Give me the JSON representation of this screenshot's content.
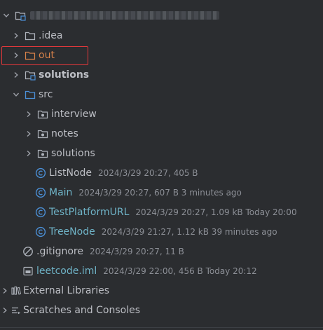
{
  "tree": {
    "idea": {
      "name": ".idea"
    },
    "out": {
      "name": "out"
    },
    "solutions_root": {
      "name": "solutions"
    },
    "src": {
      "name": "src",
      "children": [
        {
          "name": "interview"
        },
        {
          "name": "notes"
        },
        {
          "name": "solutions"
        }
      ],
      "files": [
        {
          "name": "ListNode",
          "meta": "2024/3/29 20:27, 405 B"
        },
        {
          "name": "Main",
          "meta": "2024/3/29 20:27, 607 B 3 minutes ago"
        },
        {
          "name": "TestPlatformURL",
          "meta": "2024/3/29 20:27, 1.09 kB Today 20:00"
        },
        {
          "name": "TreeNode",
          "meta": "2024/3/29 21:27, 1.12 kB 39 minutes ago"
        }
      ]
    },
    "gitignore": {
      "name": ".gitignore",
      "meta": "2024/3/29 20:27, 11 B"
    },
    "iml": {
      "name": "leetcode.iml",
      "meta": "2024/3/29 22:00, 456 B Today 20:12"
    },
    "external_libraries": {
      "name": "External Libraries"
    },
    "scratches": {
      "name": "Scratches and Consoles"
    }
  },
  "colors": {
    "background": "#2b2d30",
    "excluded_folder": "#d8824a",
    "class_icon": "#4b8fd6",
    "modified_file": "#6fb3c7",
    "highlight_box": "#e5383b"
  },
  "icons": {
    "expanded": "chevron-down-icon",
    "collapsed": "chevron-right-icon",
    "folder": "folder-icon",
    "module": "module-folder-icon",
    "source": "source-folder-icon",
    "package": "package-icon",
    "class": "class-icon",
    "ignore": "gitignore-icon",
    "iml": "iml-file-icon",
    "libraries": "libraries-icon",
    "scratches": "scratches-icon"
  }
}
